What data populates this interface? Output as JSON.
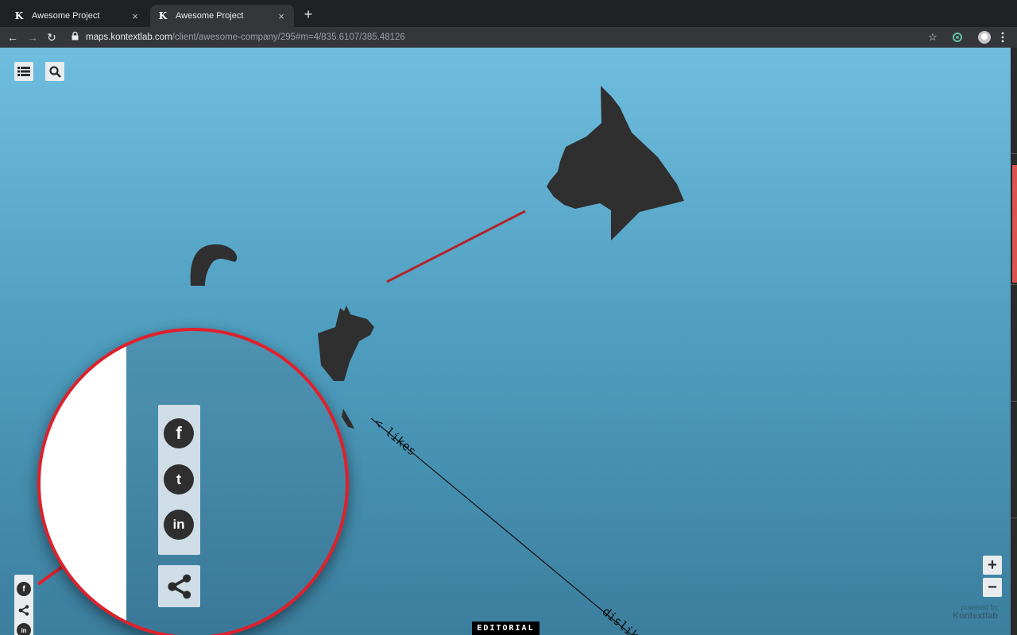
{
  "browser": {
    "tabs": [
      {
        "favicon": "K",
        "title": "Awesome Project",
        "close": "×"
      },
      {
        "favicon": "K",
        "title": "Awesome Project",
        "close": "×"
      }
    ],
    "new_tab": "+",
    "nav": {
      "back": "←",
      "forward": "→",
      "reload": "↻"
    },
    "url_host": "maps.kontextlab.com",
    "url_path": "/client/awesome-company/295#m=4/835.6107/385.48126",
    "star": "☆"
  },
  "map": {
    "label_likes": "< likes",
    "label_dislikes": "dislik",
    "editorial": "EDITORIAL",
    "powered_by": "powered by",
    "brand": "Kontextlab",
    "zoom_in": "+",
    "zoom_out": "−",
    "colors": {
      "sky_top": "#6fbddf",
      "sky_bottom": "#3c7e9e",
      "silhouette": "#2f2f2f",
      "red_line": "#b3242a",
      "magnifier_ring": "#e0202a"
    }
  },
  "toolbar_icons": [
    "list-icon",
    "search-icon"
  ],
  "social": {
    "facebook": "f",
    "twitter": "t",
    "linkedin": "in"
  }
}
